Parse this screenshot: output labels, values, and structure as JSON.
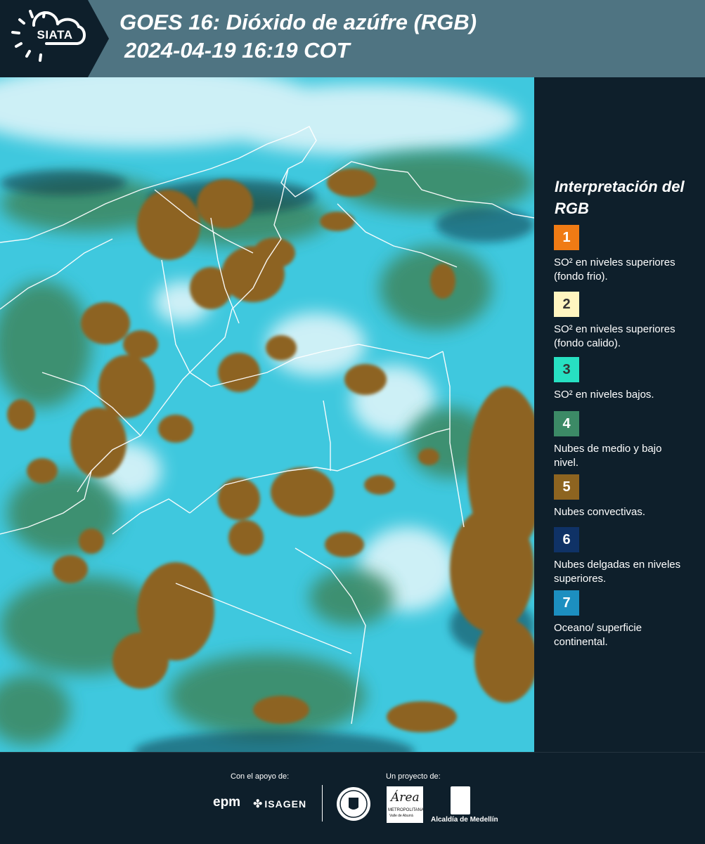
{
  "header": {
    "logo_text": "SIATA",
    "title_line1": "GOES 16: Dióxido de azúfre (RGB)",
    "title_line2": "2024-04-19 16:19 COT",
    "background_color": "#4f7482"
  },
  "legend": {
    "title": "Interpretación del RGB",
    "items": [
      {
        "number": "1",
        "label": "SO² en niveles superiores (fondo frio).",
        "color": "#f07b14",
        "text_color": "#ffffff"
      },
      {
        "number": "2",
        "label": "SO² en niveles superiores (fondo calido).",
        "color": "#fff5c0",
        "text_color": "#333333"
      },
      {
        "number": "3",
        "label": "SO² en niveles bajos.",
        "color": "#27e0c2",
        "text_color": "#333333"
      },
      {
        "number": "4",
        "label": "Nubes de medio y bajo nivel.",
        "color": "#3c8a66",
        "text_color": "#ffffff"
      },
      {
        "number": "5",
        "label": "Nubes convectivas.",
        "color": "#8d6420",
        "text_color": "#ffffff"
      },
      {
        "number": "6",
        "label": "Nubes delgadas en niveles superiores.",
        "color": "#0f3266",
        "text_color": "#ffffff"
      },
      {
        "number": "7",
        "label": "Oceano/ superficie continental.",
        "color": "#1c8fc0",
        "text_color": "#ffffff"
      }
    ]
  },
  "footer": {
    "support_caption": "Con el apoyo de:",
    "project_caption": "Un proyecto de:",
    "sponsors": [
      "epm",
      "ISAGEN"
    ],
    "area_logo_text": "Área",
    "area_logo_sub1": "METROPOLITANA",
    "area_logo_sub2": "Valle de Aburrá",
    "alcaldia_label": "Alcaldía de Medellín"
  },
  "map": {
    "background_color": "#3fc8de",
    "convective_color": "#8d6420",
    "low_cloud_color": "#3c8a66",
    "high_thin_color": "#e6f7fb",
    "border_color": "#ffffff"
  }
}
